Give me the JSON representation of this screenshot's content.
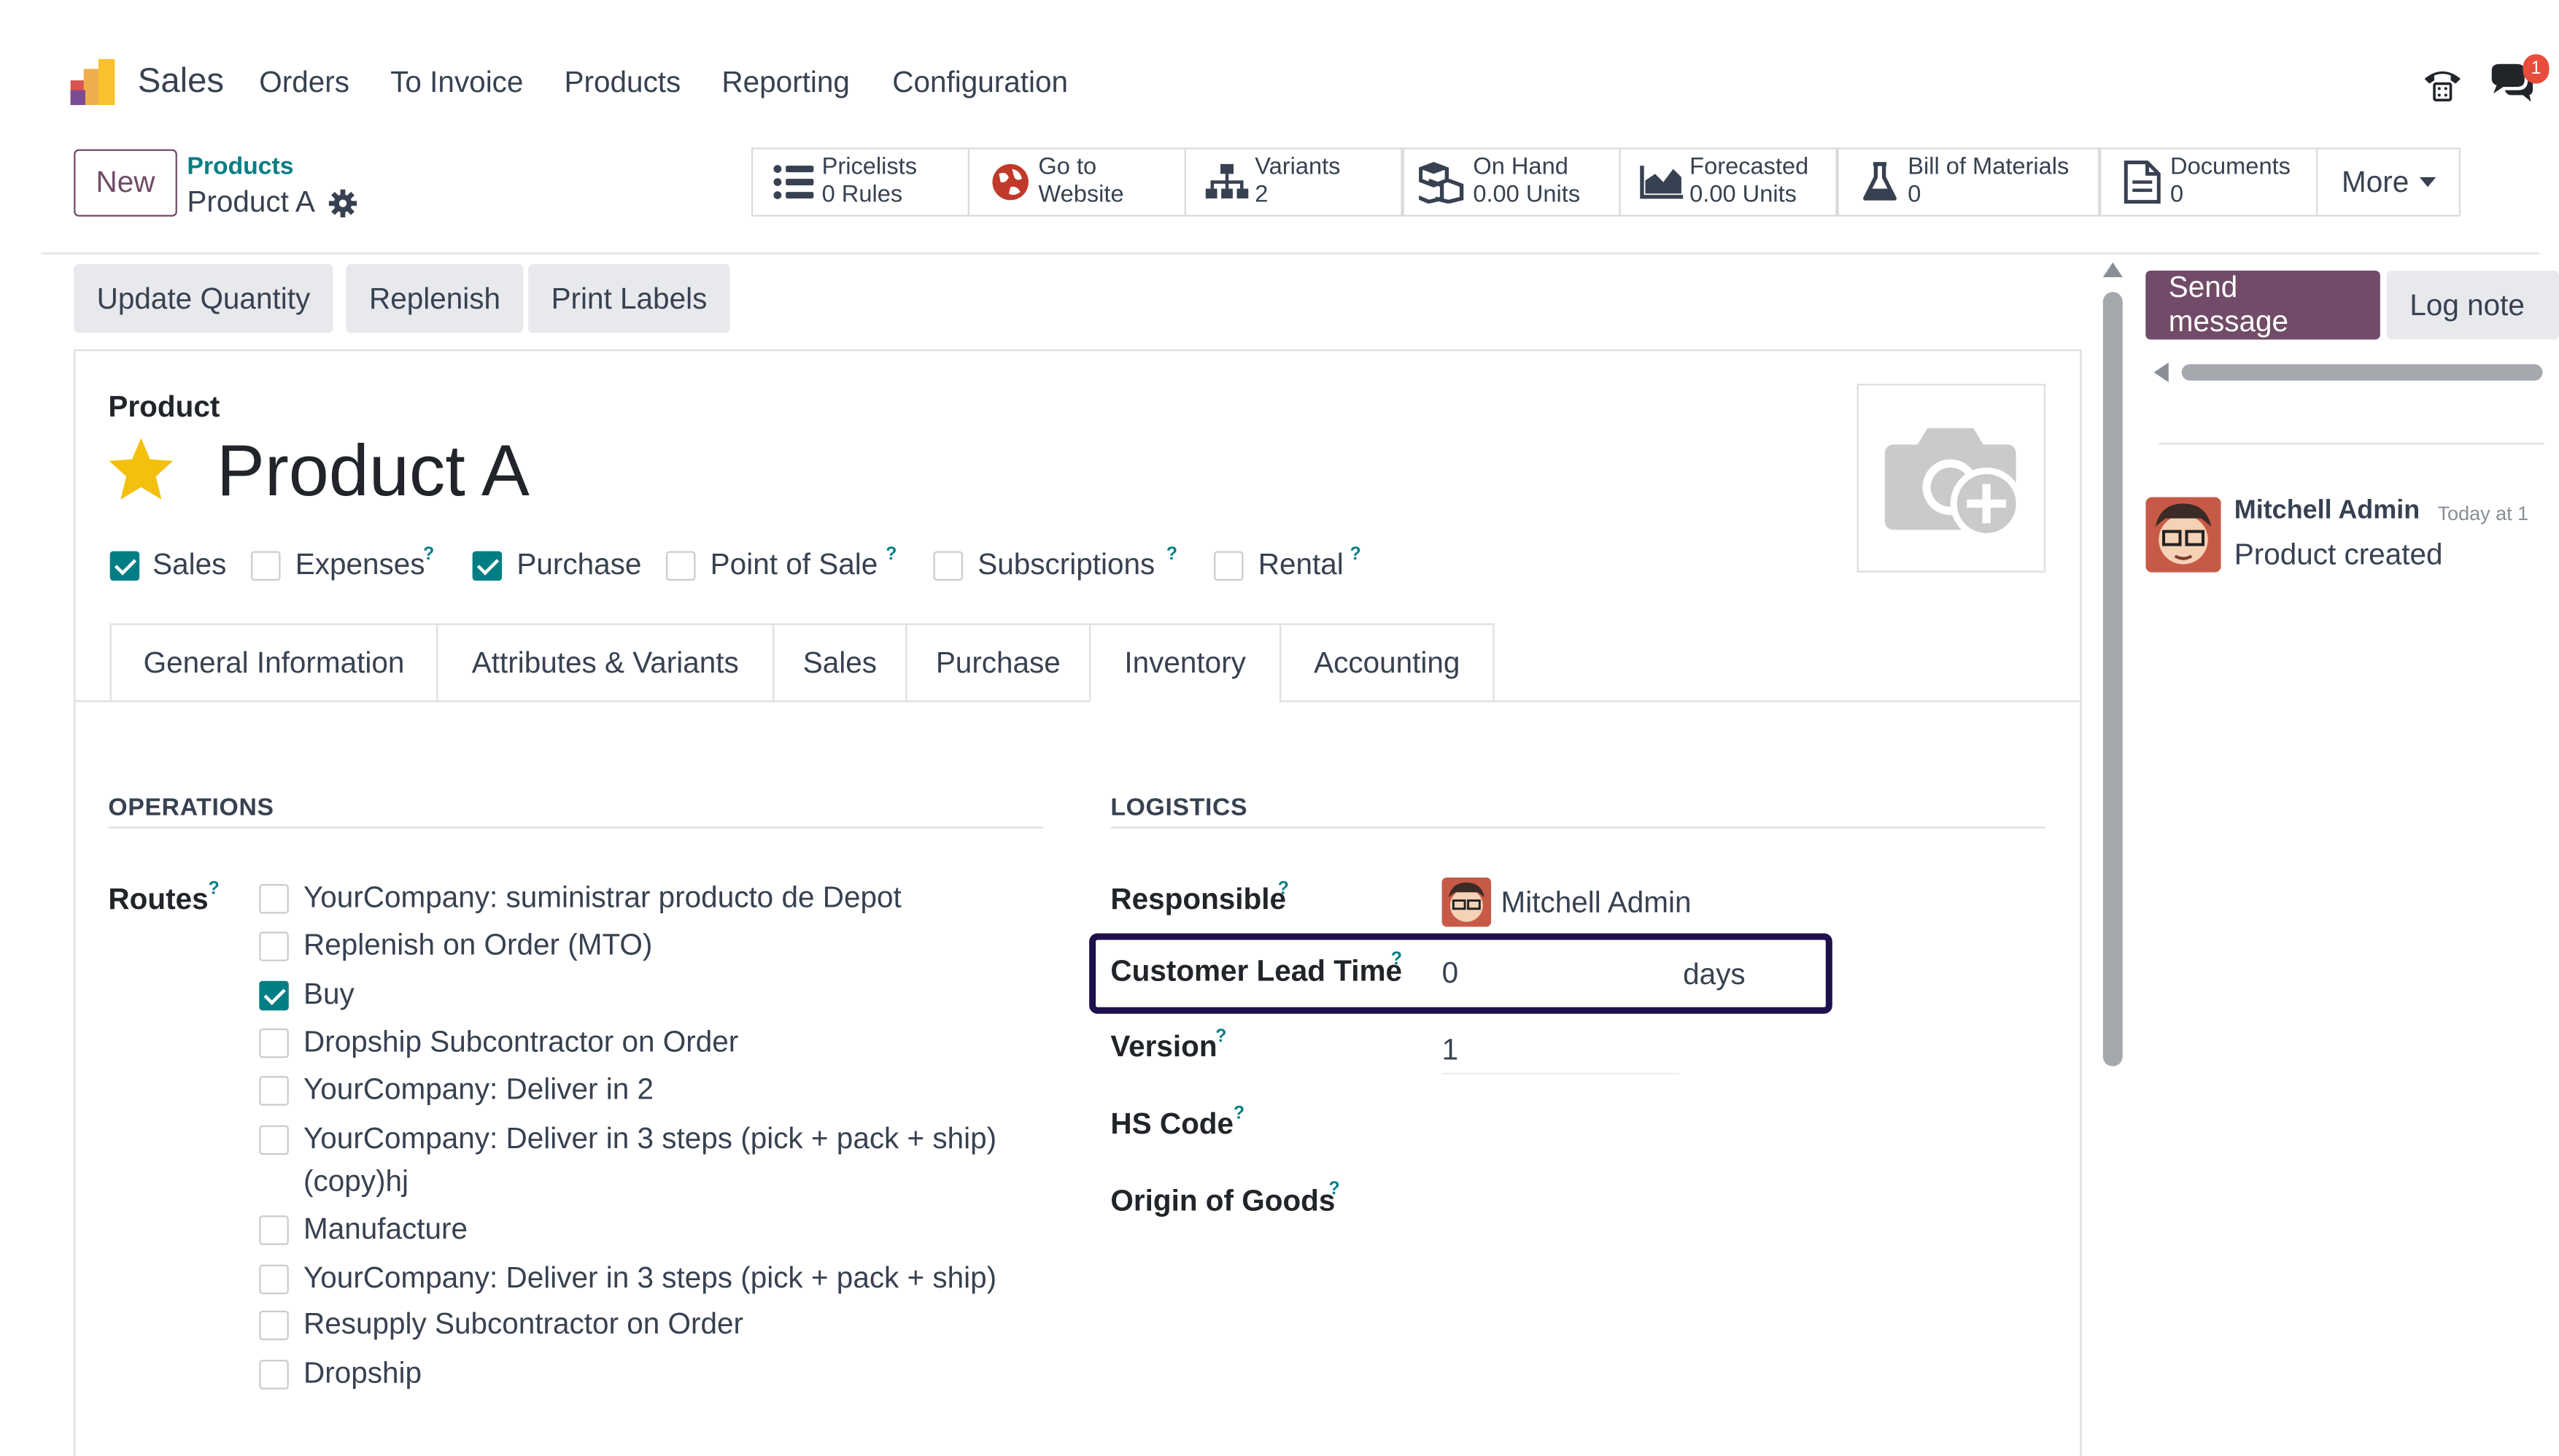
{
  "navbar": {
    "app_name": "Sales",
    "menu": [
      "Orders",
      "To Invoice",
      "Products",
      "Reporting",
      "Configuration"
    ],
    "chat_badge": "1"
  },
  "control": {
    "new_label": "New",
    "breadcrumb_parent": "Products",
    "breadcrumb_current": "Product A"
  },
  "smart_buttons": [
    {
      "icon": "list-icon",
      "label": "Pricelists",
      "value": "0 Rules"
    },
    {
      "icon": "globe-icon",
      "label": "Go to",
      "value": "Website"
    },
    {
      "icon": "sitemap-icon",
      "label": "Variants",
      "value": "2"
    },
    {
      "icon": "cubes-icon",
      "label": "On Hand",
      "value": "0.00 Units"
    },
    {
      "icon": "area-chart-icon",
      "label": "Forecasted",
      "value": "0.00 Units"
    },
    {
      "icon": "flask-icon",
      "label": "Bill of Materials",
      "value": "0"
    },
    {
      "icon": "document-icon",
      "label": "Documents",
      "value": "0"
    }
  ],
  "more_label": "More",
  "actions": [
    "Update Quantity",
    "Replenish",
    "Print Labels"
  ],
  "product": {
    "type_label": "Product",
    "name": "Product A",
    "flags": [
      {
        "label": "Sales",
        "checked": true,
        "help": false
      },
      {
        "label": "Expenses",
        "checked": false,
        "help": true
      },
      {
        "label": "Purchase",
        "checked": true,
        "help": false
      },
      {
        "label": "Point of Sale",
        "checked": false,
        "help": true
      },
      {
        "label": "Subscriptions",
        "checked": false,
        "help": true
      },
      {
        "label": "Rental",
        "checked": false,
        "help": true
      }
    ]
  },
  "tabs": [
    "General Information",
    "Attributes & Variants",
    "Sales",
    "Purchase",
    "Inventory",
    "Accounting"
  ],
  "active_tab": "Inventory",
  "help_mark": "?",
  "operations": {
    "title": "OPERATIONS",
    "routes_label": "Routes",
    "routes": [
      {
        "label": "YourCompany: suministrar producto de Depot",
        "checked": false
      },
      {
        "label": "Replenish on Order (MTO)",
        "checked": false
      },
      {
        "label": "Buy",
        "checked": true
      },
      {
        "label": "Dropship Subcontractor on Order",
        "checked": false
      },
      {
        "label": "YourCompany: Deliver in 2",
        "checked": false
      },
      {
        "label": "YourCompany: Deliver in 3 steps (pick + pack + ship)",
        "label2": "(copy)hj",
        "checked": false
      },
      {
        "label": "Manufacture",
        "checked": false
      },
      {
        "label": "YourCompany: Deliver in 3 steps (pick + pack + ship)",
        "checked": false
      },
      {
        "label": "Resupply Subcontractor on Order",
        "checked": false
      },
      {
        "label": "Dropship",
        "checked": false
      }
    ]
  },
  "logistics": {
    "title": "LOGISTICS",
    "responsible_label": "Responsible",
    "responsible_value": "Mitchell Admin",
    "lead_time_label": "Customer Lead Time",
    "lead_time_value": "0",
    "lead_time_unit": "days",
    "version_label": "Version",
    "version_value": "1",
    "hs_code_label": "HS Code",
    "origin_label": "Origin of Goods"
  },
  "chatter": {
    "send_message": "Send message",
    "log_note": "Log note",
    "author": "Mitchell Admin",
    "time": "Today at 1",
    "message": "Product created"
  },
  "colors": {
    "brand": "#714B67",
    "accent": "#017e84",
    "highlight_box": "#1f0f4d"
  }
}
